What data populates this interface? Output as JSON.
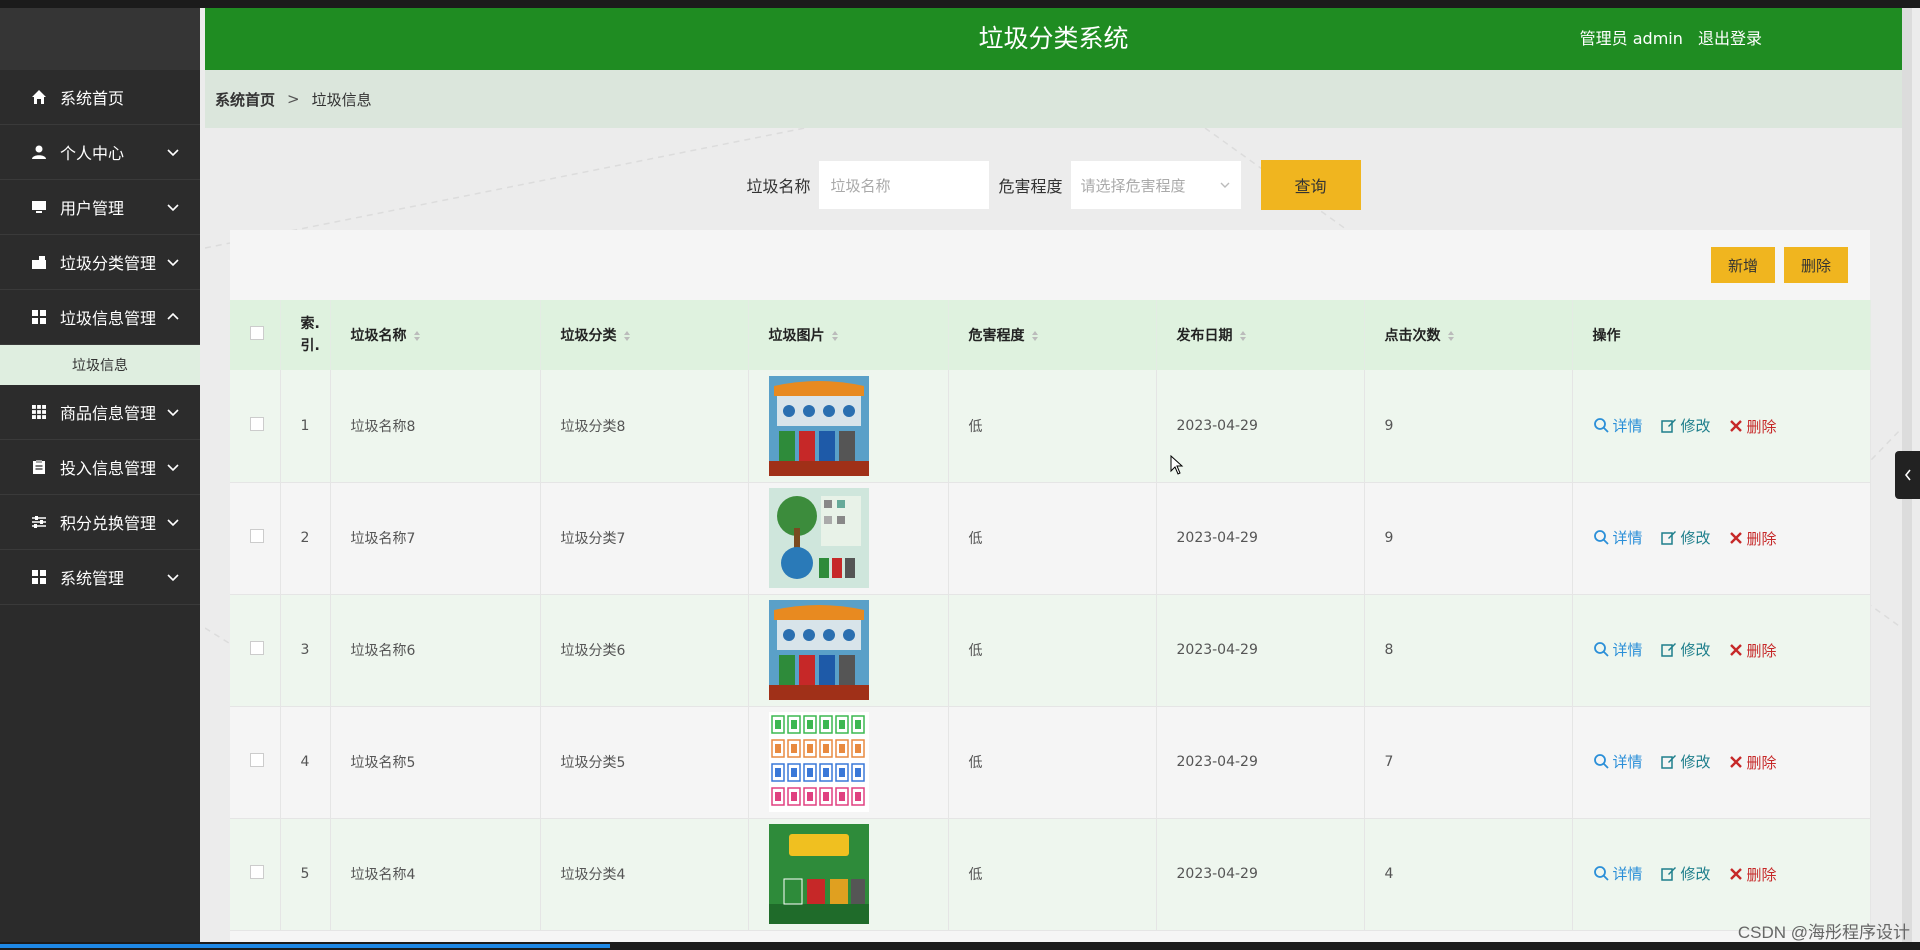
{
  "header": {
    "title": "垃圾分类系统",
    "user_label": "管理员 admin",
    "logout": "退出登录"
  },
  "sidebar": {
    "items": [
      {
        "label": "系统首页",
        "icon": "home-icon"
      },
      {
        "label": "个人中心",
        "icon": "user-icon"
      },
      {
        "label": "用户管理",
        "icon": "monitor-icon"
      },
      {
        "label": "垃圾分类管理",
        "icon": "box-icon"
      },
      {
        "label": "垃圾信息管理",
        "icon": "grid-icon",
        "expanded": true,
        "sub": [
          "垃圾信息"
        ]
      },
      {
        "label": "商品信息管理",
        "icon": "table-icon"
      },
      {
        "label": "投入信息管理",
        "icon": "clipboard-icon"
      },
      {
        "label": "积分兑换管理",
        "icon": "sliders-icon"
      },
      {
        "label": "系统管理",
        "icon": "grid-icon"
      }
    ]
  },
  "breadcrumb": {
    "home": "系统首页",
    "separator": ">",
    "current": "垃圾信息"
  },
  "search": {
    "name_label": "垃圾名称",
    "name_placeholder": "垃圾名称",
    "level_label": "危害程度",
    "level_placeholder": "请选择危害程度",
    "query_button": "查询"
  },
  "actions": {
    "add": "新增",
    "delete": "删除"
  },
  "table": {
    "columns": [
      "索引",
      "垃圾名称",
      "垃圾分类",
      "垃圾图片",
      "危害程度",
      "发布日期",
      "点击次数",
      "操作"
    ],
    "index_header_top": "索.",
    "index_header_bottom": "引.",
    "ops": {
      "view": "详情",
      "edit": "修改",
      "delete": "删除"
    },
    "rows": [
      {
        "index": "1",
        "name": "垃圾名称8",
        "category": "垃圾分类8",
        "image": "station",
        "level": "低",
        "date": "2023-04-29",
        "clicks": "9"
      },
      {
        "index": "2",
        "name": "垃圾名称7",
        "category": "垃圾分类7",
        "image": "tree",
        "level": "低",
        "date": "2023-04-29",
        "clicks": "9"
      },
      {
        "index": "3",
        "name": "垃圾名称6",
        "category": "垃圾分类6",
        "image": "station",
        "level": "低",
        "date": "2023-04-29",
        "clicks": "8"
      },
      {
        "index": "4",
        "name": "垃圾名称5",
        "category": "垃圾分类5",
        "image": "icons",
        "level": "低",
        "date": "2023-04-29",
        "clicks": "7"
      },
      {
        "index": "5",
        "name": "垃圾名称4",
        "category": "垃圾分类4",
        "image": "poster",
        "level": "低",
        "date": "2023-04-29",
        "clicks": "4"
      }
    ]
  },
  "watermark": "CSDN @海彤程序设计",
  "colors": {
    "header": "#1f8c22",
    "sidebar": "#2b2b2b",
    "accent_button": "#f0b51f",
    "row_alt": "#eef6ee"
  }
}
